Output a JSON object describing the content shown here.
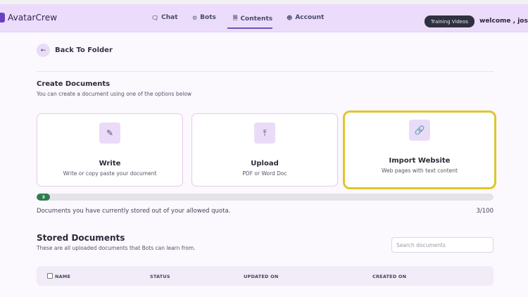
{
  "app": {
    "name": "AvatarCrew"
  },
  "nav": {
    "links": [
      {
        "label": "Chat",
        "icon": "chat-icon"
      },
      {
        "label": "Bots",
        "icon": "bot-icon"
      },
      {
        "label": "Contents",
        "icon": "document-icon",
        "active": true
      },
      {
        "label": "Account",
        "icon": "user-icon"
      }
    ],
    "training_label": "Training Videos",
    "welcome": "welcome , josh"
  },
  "back": {
    "label": "Back To Folder"
  },
  "create": {
    "title": "Create Documents",
    "subtitle": "You can create a document using one of the options below",
    "cards": [
      {
        "title": "Write",
        "desc": "Write or copy paste your document",
        "icon": "pencil-icon"
      },
      {
        "title": "Upload",
        "desc": "PDF or Word Doc",
        "icon": "upload-icon"
      },
      {
        "title": "Import Website",
        "desc": "Web pages with text content",
        "icon": "link-icon",
        "highlighted": true
      }
    ]
  },
  "quota": {
    "value": 3,
    "max": 100,
    "fill_label": "3",
    "text": "Documents you have currently stored out of your allowed quota.",
    "count": "3/100"
  },
  "stored": {
    "title": "Stored Documents",
    "subtitle": "These are all uploaded documents that Bots can learn from.",
    "search_placeholder": "Search documents"
  },
  "table": {
    "columns": [
      "NAME",
      "STATUS",
      "UPDATED ON",
      "CREATED ON"
    ]
  },
  "colors": {
    "navbar": "#ecdcfb",
    "accent": "#6b3fc4",
    "highlight_border": "#e0c62a",
    "quota_fill": "#2f7d4f"
  }
}
